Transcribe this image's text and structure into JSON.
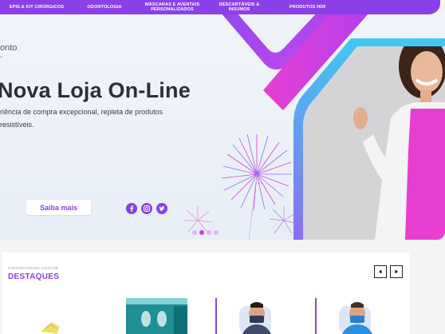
{
  "nav": {
    "items": [
      {
        "label": "EPIS & KIT CIRÚRGICOS"
      },
      {
        "label": "ODONTOLOGIA"
      },
      {
        "label": "MÁSCARAS E AVENTAIS\nPERSONALIZADOS"
      },
      {
        "label": "DESCARTÁVEIS &\nINSUMOS"
      },
      {
        "label": "PRODUTOS HOF"
      }
    ]
  },
  "hero": {
    "kicker": "onto",
    "kicker2": "-",
    "title": "Nova Loja On-Line",
    "desc_line1": "riência de compra excepcional, repleta de produtos",
    "desc_line2": "resistíveis.",
    "cta_label": "Saiba mais",
    "social_icons": [
      "facebook-icon",
      "instagram-icon",
      "twitter-icon"
    ],
    "slide_count": 4,
    "active_slide": 2,
    "colors": {
      "accent": "#8b3fe8",
      "pink": "#e63fd0",
      "cyan": "#3fb6e8"
    }
  },
  "featured": {
    "kicker": "CONFIRA NOSSA LISTA DE",
    "title": "DESTAQUES",
    "prev_label": "◀",
    "next_label": "▶"
  }
}
